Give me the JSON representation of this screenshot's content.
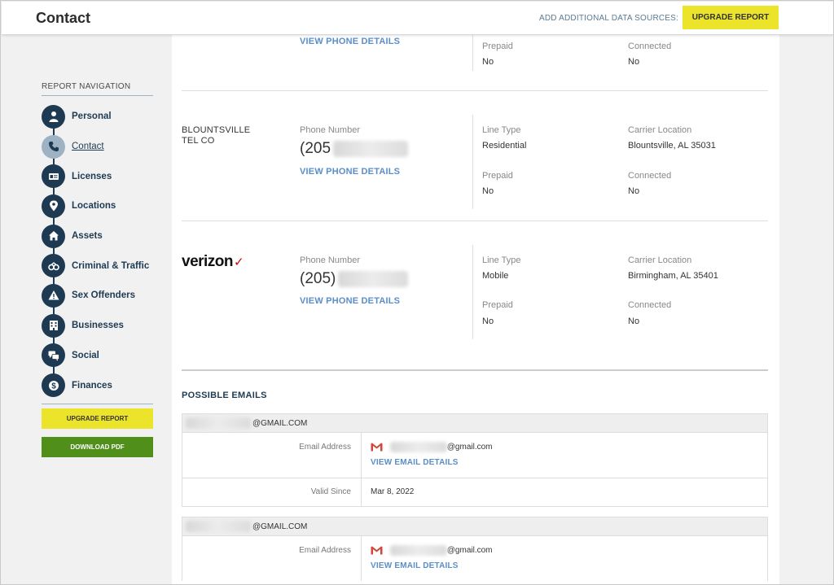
{
  "header": {
    "title": "Contact",
    "add_sources": "ADD ADDITIONAL DATA SOURCES:",
    "upgrade_label": "UPGRADE REPORT"
  },
  "sidebar": {
    "heading": "REPORT NAVIGATION",
    "items": [
      {
        "label": "Personal",
        "icon": "person-icon"
      },
      {
        "label": "Contact",
        "icon": "phone-icon",
        "active": true
      },
      {
        "label": "Licenses",
        "icon": "id-card-icon"
      },
      {
        "label": "Locations",
        "icon": "map-pin-icon"
      },
      {
        "label": "Assets",
        "icon": "house-icon"
      },
      {
        "label": "Criminal & Traffic",
        "icon": "handcuffs-icon"
      },
      {
        "label": "Sex Offenders",
        "icon": "warning-icon"
      },
      {
        "label": "Businesses",
        "icon": "building-icon"
      },
      {
        "label": "Social",
        "icon": "chat-icon"
      },
      {
        "label": "Finances",
        "icon": "dollar-icon"
      }
    ],
    "upgrade_label": "UPGRADE REPORT",
    "download_label": "DOWNLOAD PDF"
  },
  "phones": {
    "top_partial": {
      "view_link": "VIEW PHONE DETAILS",
      "prepaid_label": "Prepaid",
      "prepaid_value": "No",
      "connected_label": "Connected",
      "connected_value": "No"
    },
    "blountsville": {
      "carrier": "BLOUNTSVILLE TEL CO",
      "phone_label": "Phone Number",
      "phone_prefix": "(205",
      "view_link": "VIEW PHONE DETAILS",
      "line_type_label": "Line Type",
      "line_type_value": "Residential",
      "carrier_location_label": "Carrier Location",
      "carrier_location_value": "Blountsville, AL 35031",
      "prepaid_label": "Prepaid",
      "prepaid_value": "No",
      "connected_label": "Connected",
      "connected_value": "No"
    },
    "verizon": {
      "logo_text": "verizon",
      "logo_check": "✓",
      "phone_label": "Phone Number",
      "phone_prefix": "(205)",
      "view_link": "VIEW PHONE DETAILS",
      "line_type_label": "Line Type",
      "line_type_value": "Mobile",
      "carrier_location_label": "Carrier Location",
      "carrier_location_value": "Birmingham, AL 35401",
      "prepaid_label": "Prepaid",
      "prepaid_value": "No",
      "connected_label": "Connected",
      "connected_value": "No"
    }
  },
  "emails": {
    "section_title": "POSSIBLE EMAILS",
    "entries": [
      {
        "header_domain": "@GMAIL.COM",
        "address_label": "Email Address",
        "address_domain": "@gmail.com",
        "view_link": "VIEW EMAIL DETAILS",
        "valid_since_label": "Valid Since",
        "valid_since_value": "Mar 8, 2022"
      },
      {
        "header_domain": "@GMAIL.COM",
        "address_label": "Email Address",
        "address_domain": "@gmail.com",
        "view_link": "VIEW EMAIL DETAILS"
      }
    ]
  },
  "colors": {
    "navy": "#1e3a52",
    "accent_yellow": "#ece42a",
    "download_green": "#4f8f1a",
    "link_blue": "#5b8ec7",
    "verizon_red": "#cd040b"
  }
}
